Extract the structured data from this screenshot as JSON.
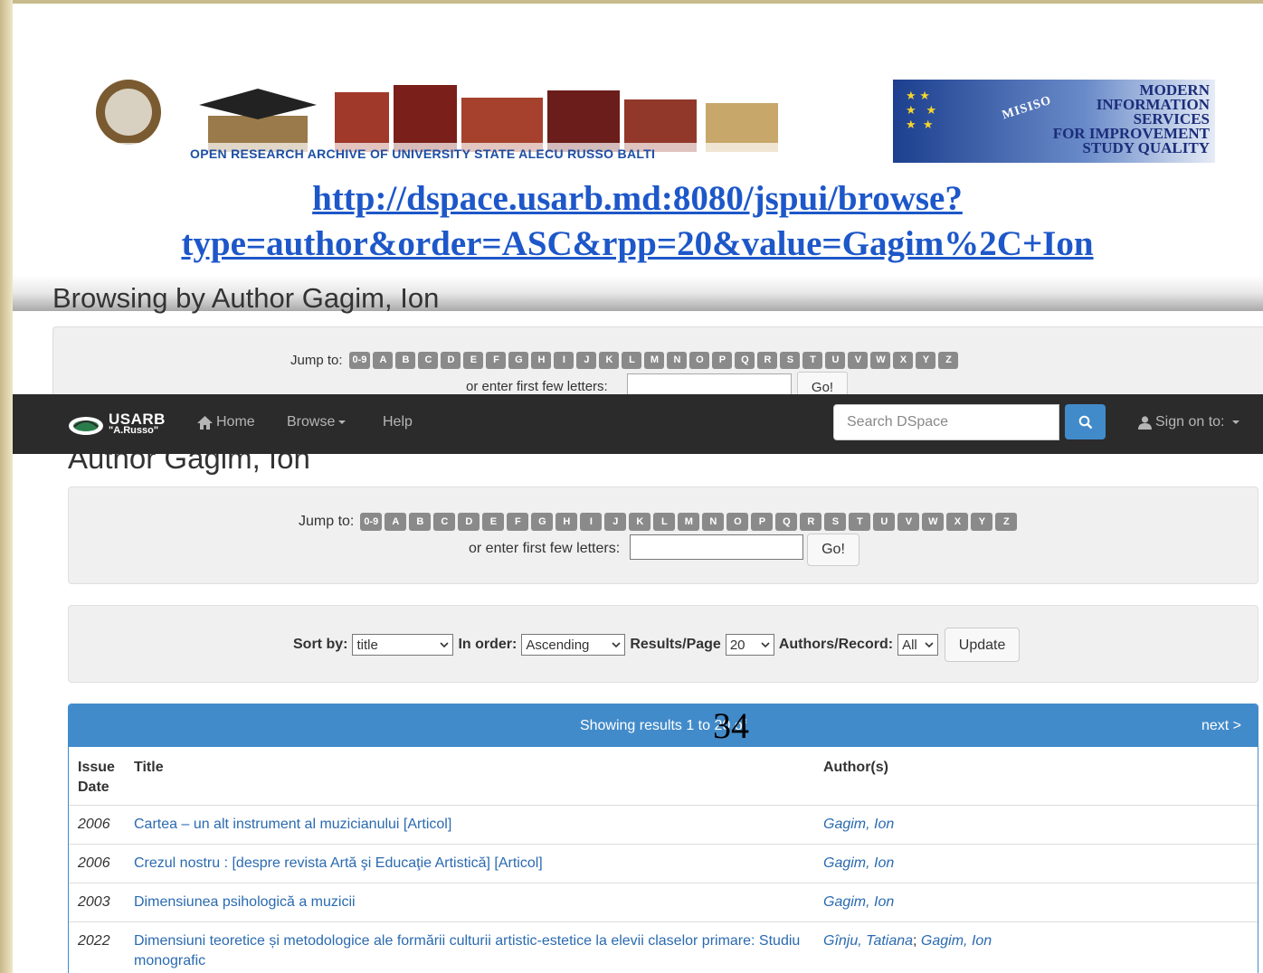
{
  "slide": {
    "banner_text": "OPEN RESEARCH ARCHIVE OF UNIVERSITY STATE ALECU RUSSO BALTI",
    "eu_lines": [
      "MODERN",
      "INFORMATION",
      "SERVICES",
      "FOR IMPROVEMENT",
      "STUDY QUALITY"
    ],
    "eu_acronym": "MISISO",
    "url": "http://dspace.usarb.md:8080/jspui/browse?type=author&order=ASC&rpp=20&value=Gagim%2C+Ion",
    "upper_heading": "Browsing by Author Gagim, Ion",
    "upper_jump_label": "Jump to:",
    "upper_enter_label": "or enter first few letters:",
    "upper_go": "Go!"
  },
  "navbar": {
    "brand_top": "USARB",
    "brand_bottom": "\"A.Russo\"",
    "home": "Home",
    "browse": "Browse",
    "help": "Help",
    "search_placeholder": "Search DSpace",
    "sign_on": "Sign on to:"
  },
  "heading": "Author Gagim, Ion",
  "jump": {
    "label": "Jump to:",
    "letters": [
      "0-9",
      "A",
      "B",
      "C",
      "D",
      "E",
      "F",
      "G",
      "H",
      "I",
      "J",
      "K",
      "L",
      "M",
      "N",
      "O",
      "P",
      "Q",
      "R",
      "S",
      "T",
      "U",
      "V",
      "W",
      "X",
      "Y",
      "Z"
    ],
    "enter_label": "or enter first few letters:",
    "go": "Go!"
  },
  "sort": {
    "sort_by_label": "Sort by:",
    "sort_by_value": "title",
    "order_label": "In order:",
    "order_value": "Ascending",
    "rpp_label": "Results/Page",
    "rpp_value": "20",
    "authors_label": "Authors/Record:",
    "authors_value": "All",
    "update": "Update"
  },
  "results": {
    "showing": "Showing results 1 to 20 of",
    "total": "34",
    "next": "next >",
    "headers": {
      "date_line1": "Issue",
      "date_line2": "Date",
      "title": "Title",
      "authors": "Author(s)"
    },
    "rows": [
      {
        "date": "2006",
        "title": "Cartea – un alt instrument al muzicianului [Articol]",
        "authors": [
          "Gagim, Ion"
        ]
      },
      {
        "date": "2006",
        "title": "Crezul nostru : [despre revista Artă şi Educaţie Artistică] [Articol]",
        "authors": [
          "Gagim, Ion"
        ]
      },
      {
        "date": "2003",
        "title": "Dimensiunea psihologică a muzicii",
        "authors": [
          "Gagim, Ion"
        ]
      },
      {
        "date": "2022",
        "title": "Dimensiuni teoretice și metodologice ale formării culturii artistic-estetice la elevii claselor primare: Studiu monografic",
        "authors": [
          "Gînju, Tatiana",
          "Gagim, Ion"
        ]
      }
    ]
  },
  "colors": {
    "primary": "#428bca",
    "navbar": "#2b2b2b",
    "link": "#2a6ab0",
    "url": "#1d57c9"
  }
}
